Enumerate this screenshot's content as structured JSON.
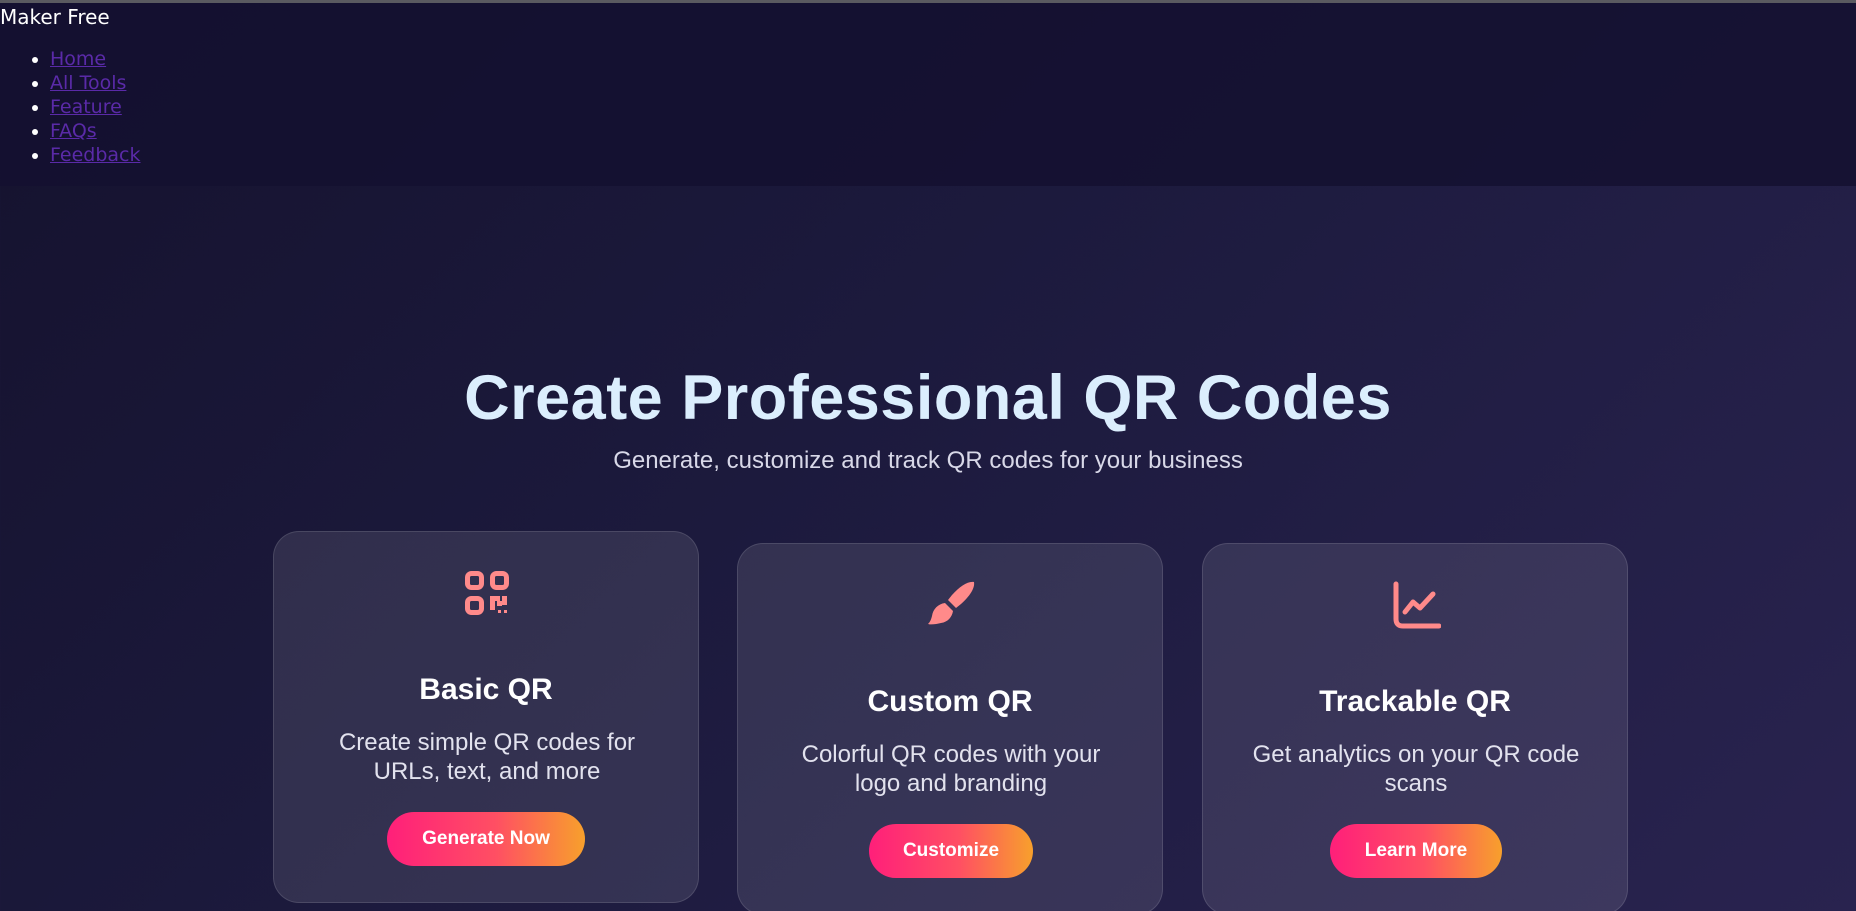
{
  "header": {
    "brand": "Maker Free",
    "nav": [
      {
        "label": "Home"
      },
      {
        "label": "All Tools"
      },
      {
        "label": "Feature"
      },
      {
        "label": "FAQs"
      },
      {
        "label": "Feedback"
      }
    ]
  },
  "hero": {
    "title": "Create Professional QR Codes",
    "subtitle": "Generate, customize and track QR codes for your business"
  },
  "cards": [
    {
      "icon": "qrcode-icon",
      "title": "Basic QR",
      "description": "Create simple QR codes for URLs, text, and more",
      "button": "Generate Now"
    },
    {
      "icon": "paintbrush-icon",
      "title": "Custom QR",
      "description": "Colorful QR codes with your logo and branding",
      "button": "Customize"
    },
    {
      "icon": "chart-line-icon",
      "title": "Trackable QR",
      "description": "Get analytics on your QR code scans",
      "button": "Learn More"
    }
  ],
  "colors": {
    "accent_icon": "#ff8a8a",
    "button_gradient_start": "#ff1f7a",
    "button_gradient_end": "#f7a02c",
    "link": "#5a2aa8",
    "hero_title": "#dbeefd"
  }
}
